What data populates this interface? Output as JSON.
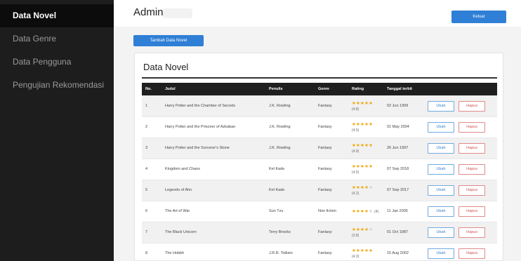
{
  "sidebar": {
    "items": [
      {
        "label": "Data Novel"
      },
      {
        "label": "Data Genre"
      },
      {
        "label": "Data Pengguna"
      },
      {
        "label": "Pengujian Rekomendasi"
      }
    ]
  },
  "header": {
    "title": "Admin",
    "logout_label": "Keluar"
  },
  "actions": {
    "add_label": "Tambah Data Novel"
  },
  "card": {
    "title": "Data Novel"
  },
  "table": {
    "columns": [
      "No.",
      "Judul",
      "Penulis",
      "Genre",
      "Rating",
      "Tanggal terbit",
      ""
    ],
    "edit_label": "Ubah",
    "delete_label": "Hapus",
    "rows": [
      {
        "no": "1",
        "title": "Harry Potter and the Chamber of Secrets",
        "author": "J.K. Rowling",
        "genre": "Fantasy",
        "stars": 4.8,
        "rating": "(4.8)",
        "date": "02 Jun 1999"
      },
      {
        "no": "2",
        "title": "Harry Potter and the Prisoner of Azkaban",
        "author": "J.K. Rowling",
        "genre": "Fantasy",
        "stars": 4.5,
        "rating": "(4.5)",
        "date": "01 May 2004"
      },
      {
        "no": "3",
        "title": "Harry Potter and the Sorcerer's Stone",
        "author": "J.K. Rowling",
        "genre": "Fantasy",
        "stars": 4.9,
        "rating": "(4.9)",
        "date": "26 Jun 1997"
      },
      {
        "no": "4",
        "title": "Kingdom and Chaos",
        "author": "Kel Kade",
        "genre": "Fantasy",
        "stars": 4.5,
        "rating": "(4.5)",
        "date": "07 Sep 2018"
      },
      {
        "no": "5",
        "title": "Legends of Ahn",
        "author": "Kel Kade",
        "genre": "Fantasy",
        "stars": 4.2,
        "rating": "(4.2)",
        "date": "07 Sep 2017"
      },
      {
        "no": "6",
        "title": "The Art of War",
        "author": "Sun Tzu",
        "genre": "Non fiction",
        "stars": 4.0,
        "rating": "(4)",
        "date": "11 Jan 2005"
      },
      {
        "no": "7",
        "title": "The Black Unicorn",
        "author": "Terry Brooks",
        "genre": "Fantasy",
        "stars": 3.8,
        "rating": "(3.8)",
        "date": "01 Oct 1987"
      },
      {
        "no": "8",
        "title": "The Hobbit",
        "author": "J.R.R. Tolkien",
        "genre": "Fantasy",
        "stars": 4.3,
        "rating": "(4.3)",
        "date": "15 Aug 2002"
      }
    ]
  }
}
